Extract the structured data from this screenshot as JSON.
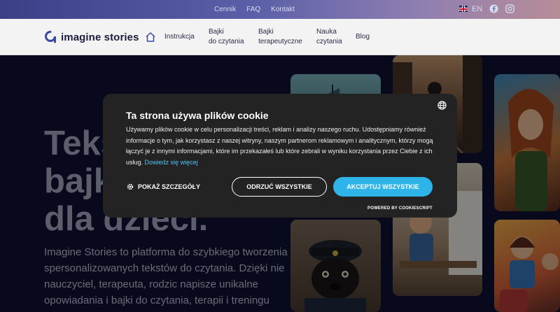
{
  "topbar": {
    "links": [
      "Cennik",
      "FAQ",
      "Kontakt"
    ],
    "lang": "EN",
    "icons": [
      "uk-flag-icon",
      "facebook-icon",
      "instagram-icon"
    ]
  },
  "nav": {
    "logo_text": "imagine stories",
    "items": [
      {
        "line1": "Instrukcja",
        "line2": ""
      },
      {
        "line1": "Bajki",
        "line2": "do czytania"
      },
      {
        "line1": "Bajki",
        "line2": "terapeutyczne"
      },
      {
        "line1": "Nauka",
        "line2": "czytania"
      },
      {
        "line1": "Blog",
        "line2": ""
      }
    ]
  },
  "hero": {
    "title_lines": [
      "Teksty i",
      "bajki",
      "dla dzieci."
    ],
    "text_lines": [
      "Imagine Stories to platforma do szybkiego tworzenia",
      "spersonalizowanych tekstów do czytania. Dzięki nie",
      "nauczyciel, terapeuta, rodzic napisze unikalne",
      "opowiadania i bajki do czytania, terapii i treningu czytania."
    ]
  },
  "cookie": {
    "title": "Ta strona używa plików cookie",
    "description": "Używamy plików cookie w celu personalizacji treści, reklam i analizy naszego ruchu. Udostępniamy również informacje o tym, jak korzystasz z naszej witryny, naszym partnerom reklamowym i analitycznym, którzy mogą łączyć je z innymi informacjami, które im przekazałeś lub które zebrali w wyniku korzystania przez Ciebie z ich usług.",
    "learn_more": "Dowiedz się więcej",
    "details_label": "POKAŻ SZCZEGÓŁY",
    "reject_label": "ODRZUĆ WSZYSTKIE",
    "accept_label": "AKCEPTUJ WSZYSTKIE",
    "powered_by": "POWERED BY COOKIESCRIPT"
  },
  "colors": {
    "accent": "#2fb4ea",
    "banner_bg": "#232323",
    "page_bg": "#0f1133",
    "logo": "#3b4aa0"
  }
}
